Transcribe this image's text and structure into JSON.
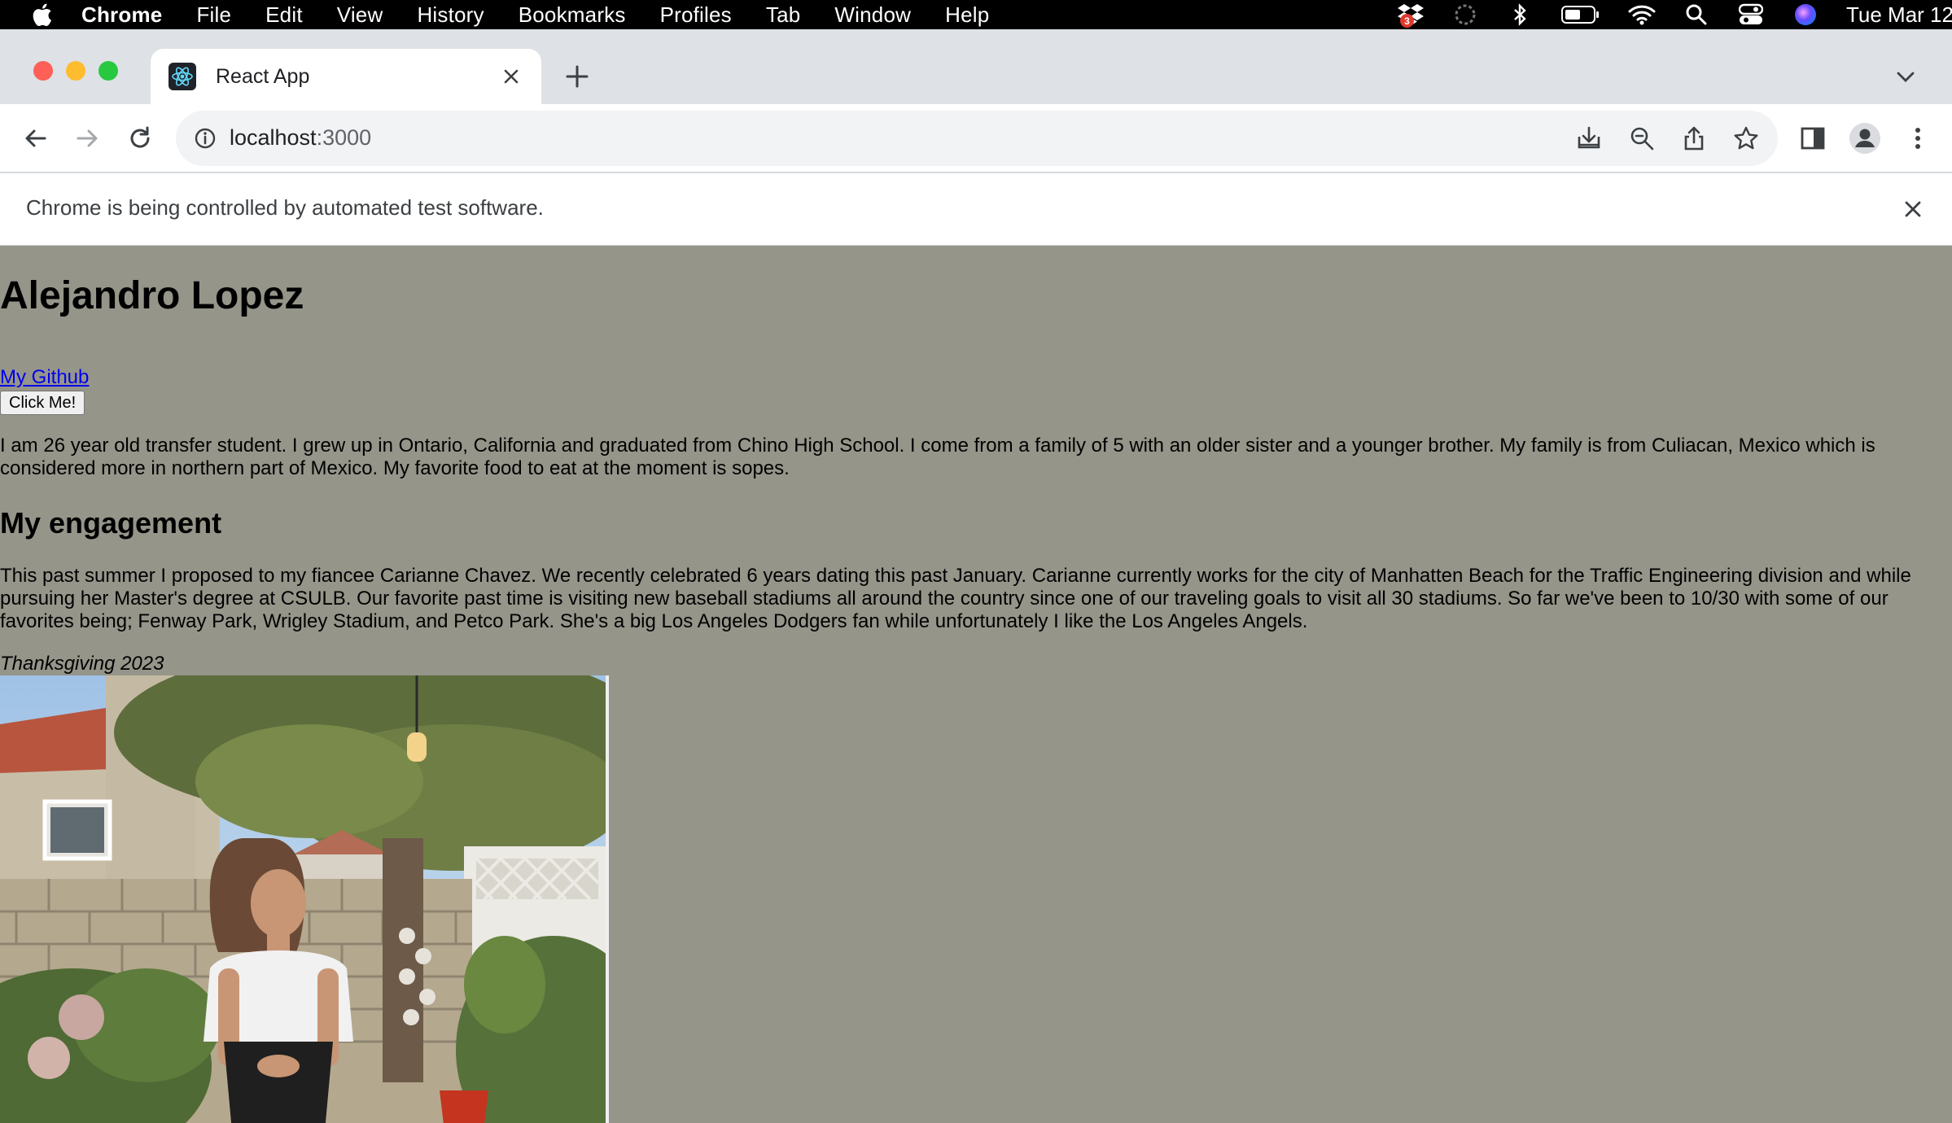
{
  "menubar": {
    "app": "Chrome",
    "items": [
      "File",
      "Edit",
      "View",
      "History",
      "Bookmarks",
      "Profiles",
      "Tab",
      "Window",
      "Help"
    ],
    "dropbox_badge": "3",
    "clock": "Tue Mar 12"
  },
  "tab": {
    "title": "React App"
  },
  "address": {
    "host": "localhost",
    "port": ":3000"
  },
  "infobar": {
    "text": "Chrome is being controlled by automated test software."
  },
  "page": {
    "name": "Alejandro Lopez",
    "github_link": "My Github",
    "button": "Click Me!",
    "intro": "I am 26 year old transfer student. I grew up in Ontario, California and graduated from Chino High School. I come from a family of 5 with an older sister and a younger brother. My family is from Culiacan, Mexico which is considered more in northern part of Mexico. My favorite food to eat at the moment is sopes.",
    "engagement_heading": "My engagement",
    "engagement_text": "This past summer I proposed to my fiancee Carianne Chavez. We recently celebrated 6 years dating this past January. Carianne currently works for the city of Manhatten Beach for the Traffic Engineering division and while pursuing her Master's degree at CSULB. Our favorite past time is visiting new baseball stadiums all around the country since one of our traveling goals to visit all 30 stadiums. So far we've been to 10/30 with some of our favorites being; Fenway Park, Wrigley Stadium, and Petco Park. She's a big Los Angeles Dodgers fan while unfortunately I like the Los Angeles Angels.",
    "photo_caption": "Thanksgiving 2023"
  },
  "colors": {
    "page_bg": "#95958a",
    "link": "#0000ee",
    "tab_strip": "#dee1e6"
  }
}
